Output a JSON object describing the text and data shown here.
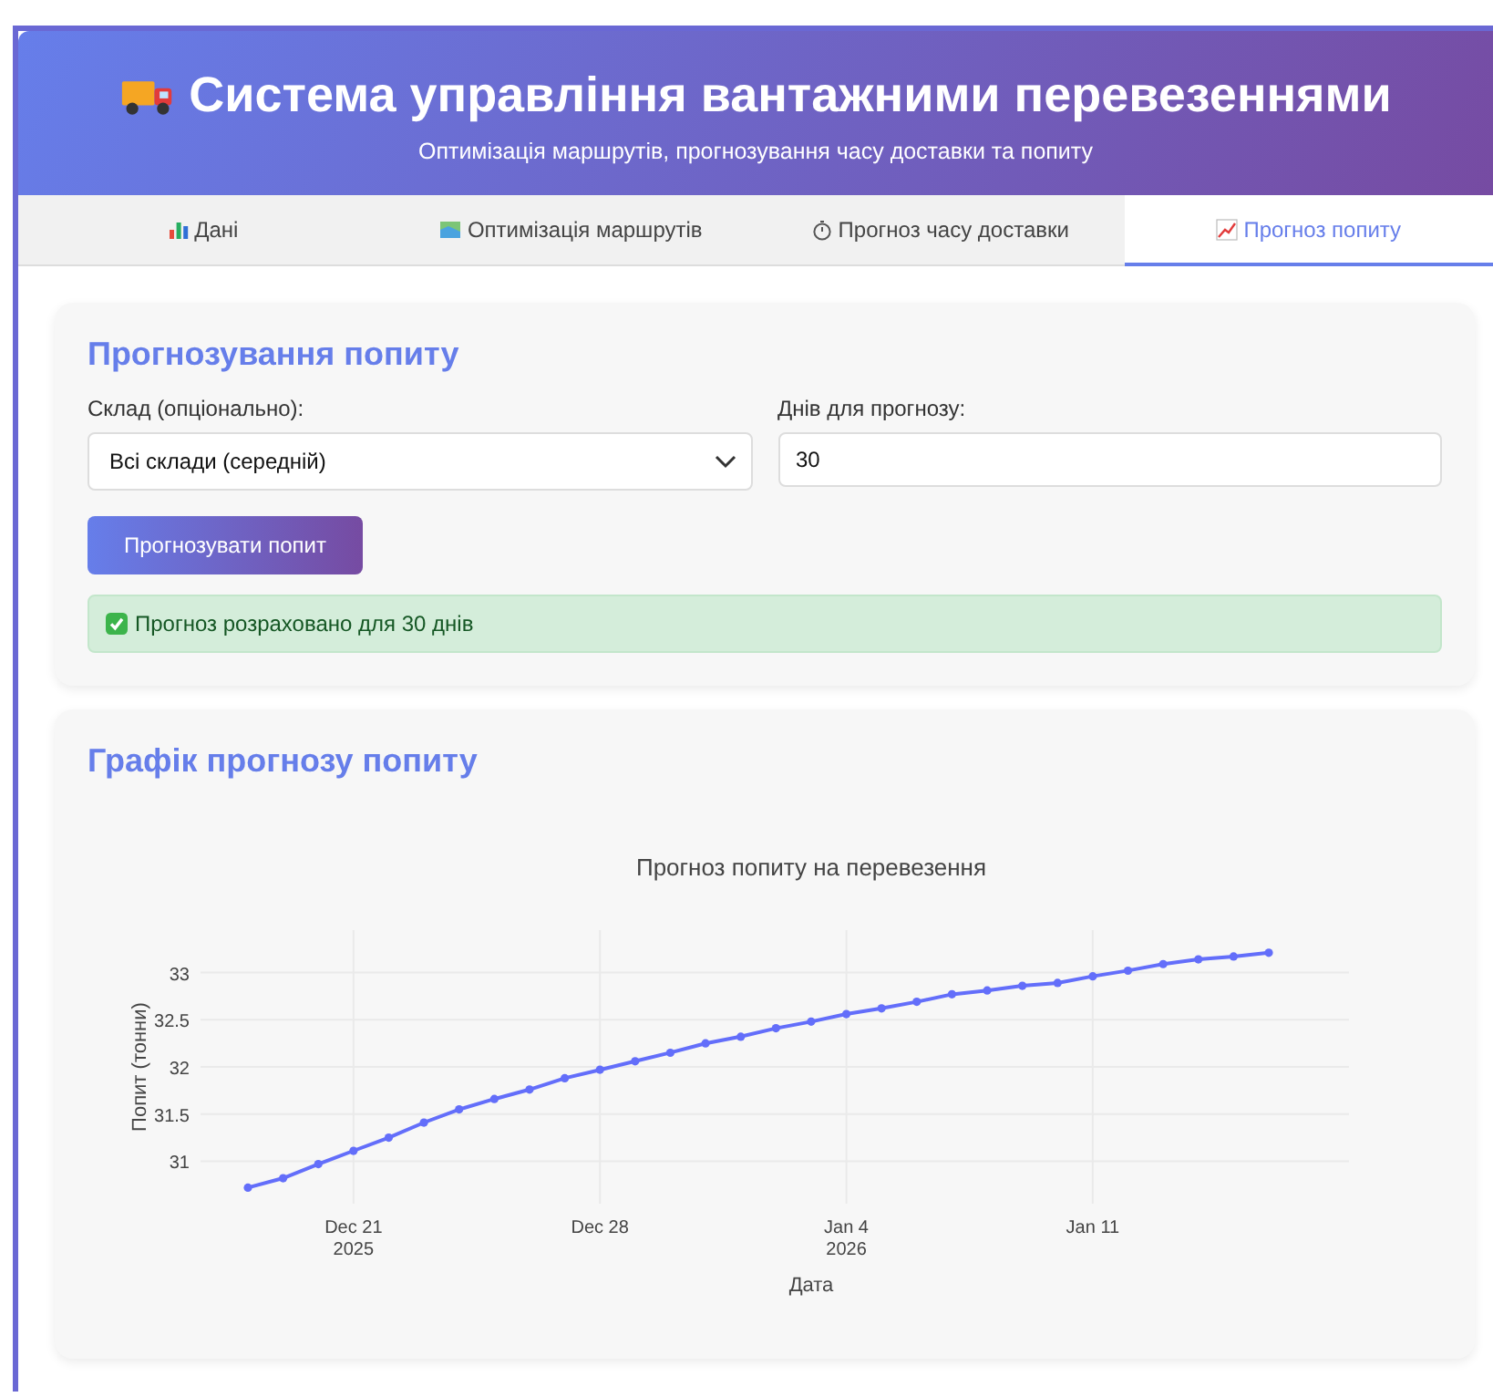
{
  "header": {
    "title": "Система управління вантажними перевезеннями",
    "subtitle": "Оптимізація маршрутів, прогнозування часу доставки та попиту"
  },
  "tabs": [
    {
      "label": "Дані",
      "kind": "data",
      "selected": false
    },
    {
      "label": "Оптимізація маршрутів",
      "kind": "map",
      "selected": false
    },
    {
      "label": "Прогноз часу доставки",
      "kind": "timer",
      "selected": false
    },
    {
      "label": "Прогноз попиту",
      "kind": "trend",
      "selected": true
    }
  ],
  "form": {
    "title": "Прогнозування попиту",
    "warehouse_label": "Склад (опціонально):",
    "warehouse_value": "Всі склади (середній)",
    "days_label": "Днів для прогнозу:",
    "days_value": "30",
    "button": "Прогнозувати попит",
    "success": "Прогноз розраховано для 30 днів"
  },
  "chart_card": {
    "title": "Графік прогнозу попиту",
    "chart_data": {
      "type": "line",
      "title": "Прогноз попиту на перевезення",
      "xlabel": "Дата",
      "ylabel": "Попит (тонни)",
      "categories": [
        null,
        null,
        null,
        "Dec 21\n2025",
        null,
        null,
        null,
        null,
        null,
        null,
        "Dec 28",
        null,
        null,
        null,
        null,
        null,
        null,
        "Jan 4\n2026",
        null,
        null,
        null,
        null,
        null,
        null,
        "Jan 11",
        null,
        null,
        null,
        null,
        null
      ],
      "grid": true,
      "series": [
        {
          "color": "#636efa",
          "marker": true,
          "values": [
            30.72,
            30.82,
            30.97,
            31.11,
            31.25,
            31.41,
            31.55,
            31.66,
            31.76,
            31.88,
            31.97,
            32.06,
            32.15,
            32.25,
            32.32,
            32.41,
            32.48,
            32.56,
            32.62,
            32.69,
            32.77,
            32.81,
            32.86,
            32.89,
            32.96,
            33.02,
            33.09,
            33.14,
            33.17,
            33.21
          ]
        }
      ],
      "ylim": [
        30.55,
        33.45
      ],
      "yticks": [
        31,
        31.5,
        32,
        32.5,
        33
      ]
    }
  }
}
